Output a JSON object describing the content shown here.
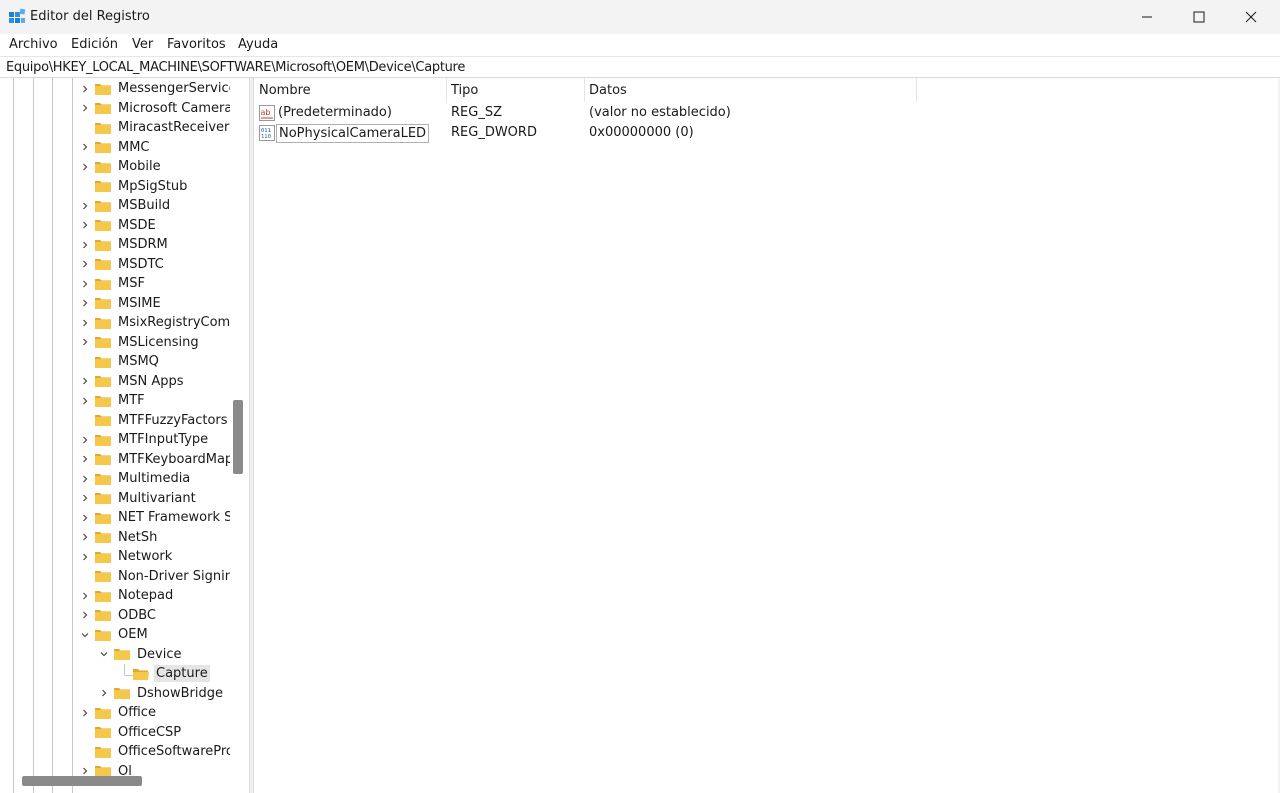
{
  "window": {
    "title": "Editor del Registro",
    "icon": "regedit-icon",
    "controls": [
      "minimize-icon",
      "maximize-icon",
      "close-icon"
    ]
  },
  "menu": [
    "Archivo",
    "Edición",
    "Ver",
    "Favoritos",
    "Ayuda"
  ],
  "address": "Equipo\\HKEY_LOCAL_MACHINE\\SOFTWARE\\Microsoft\\OEM\\Device\\Capture",
  "tree": [
    {
      "label": "MessengerService",
      "expander": "collapsed",
      "level": 0
    },
    {
      "label": "Microsoft Camera",
      "expander": "collapsed",
      "level": 0
    },
    {
      "label": "MiracastReceiver",
      "expander": "none",
      "level": 0
    },
    {
      "label": "MMC",
      "expander": "collapsed",
      "level": 0
    },
    {
      "label": "Mobile",
      "expander": "collapsed",
      "level": 0
    },
    {
      "label": "MpSigStub",
      "expander": "none",
      "level": 0
    },
    {
      "label": "MSBuild",
      "expander": "collapsed",
      "level": 0
    },
    {
      "label": "MSDE",
      "expander": "collapsed",
      "level": 0
    },
    {
      "label": "MSDRM",
      "expander": "collapsed",
      "level": 0
    },
    {
      "label": "MSDTC",
      "expander": "collapsed",
      "level": 0
    },
    {
      "label": "MSF",
      "expander": "collapsed",
      "level": 0
    },
    {
      "label": "MSIME",
      "expander": "collapsed",
      "level": 0
    },
    {
      "label": "MsixRegistryComp",
      "expander": "collapsed",
      "level": 0
    },
    {
      "label": "MSLicensing",
      "expander": "collapsed",
      "level": 0
    },
    {
      "label": "MSMQ",
      "expander": "none",
      "level": 0
    },
    {
      "label": "MSN Apps",
      "expander": "collapsed",
      "level": 0
    },
    {
      "label": "MTF",
      "expander": "collapsed",
      "level": 0
    },
    {
      "label": "MTFFuzzyFactors",
      "expander": "none",
      "level": 0
    },
    {
      "label": "MTFInputType",
      "expander": "collapsed",
      "level": 0
    },
    {
      "label": "MTFKeyboardMap",
      "expander": "collapsed",
      "level": 0
    },
    {
      "label": "Multimedia",
      "expander": "collapsed",
      "level": 0
    },
    {
      "label": "Multivariant",
      "expander": "collapsed",
      "level": 0
    },
    {
      "label": "NET Framework Se",
      "expander": "collapsed",
      "level": 0
    },
    {
      "label": "NetSh",
      "expander": "collapsed",
      "level": 0
    },
    {
      "label": "Network",
      "expander": "collapsed",
      "level": 0
    },
    {
      "label": "Non-Driver Signin",
      "expander": "none",
      "level": 0
    },
    {
      "label": "Notepad",
      "expander": "collapsed",
      "level": 0
    },
    {
      "label": "ODBC",
      "expander": "collapsed",
      "level": 0
    },
    {
      "label": "OEM",
      "expander": "expanded",
      "level": 0
    },
    {
      "label": "Device",
      "expander": "expanded",
      "level": 1
    },
    {
      "label": "Capture",
      "expander": "none",
      "level": 2,
      "selected": true
    },
    {
      "label": "DshowBridge",
      "expander": "collapsed",
      "level": 1
    },
    {
      "label": "Office",
      "expander": "collapsed",
      "level": 0
    },
    {
      "label": "OfficeCSP",
      "expander": "none",
      "level": 0
    },
    {
      "label": "OfficeSoftwarePro",
      "expander": "none",
      "level": 0
    },
    {
      "label": "Ol",
      "expander": "collapsed",
      "level": 0
    }
  ],
  "list": {
    "columns": [
      "Nombre",
      "Tipo",
      "Datos"
    ],
    "rows": [
      {
        "name": "(Predeterminado)",
        "type": "REG_SZ",
        "data": "(valor no establecido)",
        "icon": "reg-sz-icon"
      },
      {
        "name": "NoPhysicalCameraLED",
        "type": "REG_DWORD",
        "data": "0x00000000 (0)",
        "icon": "reg-dword-icon",
        "focused": true
      }
    ]
  },
  "colors": {
    "folder": "#f5c84c",
    "folder_dark": "#e0a92a",
    "selection": "#e5e5e5",
    "titlebar": "#f3f3f3"
  }
}
